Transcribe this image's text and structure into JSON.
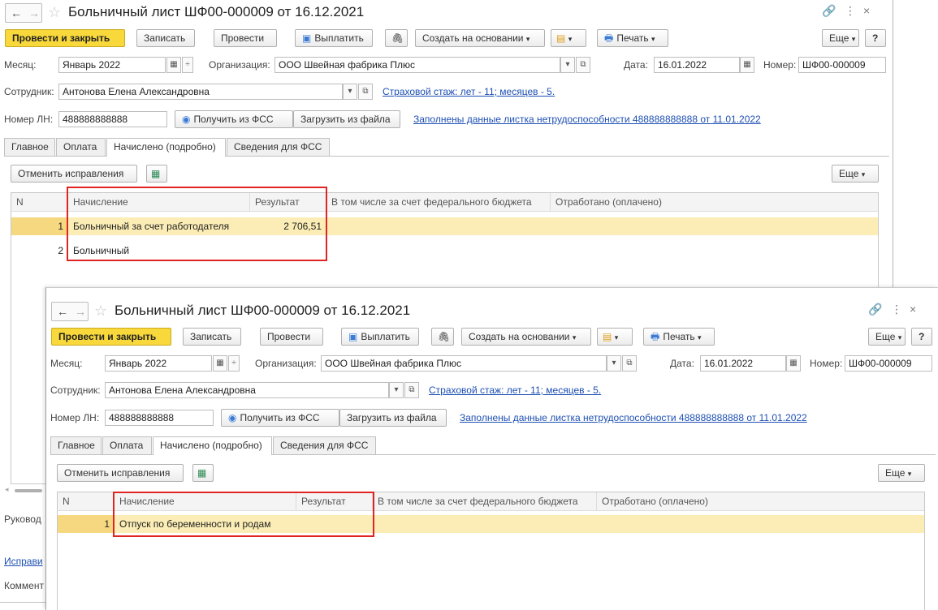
{
  "window": {
    "title": "Больничный лист ШФ00-000009 от 16.12.2021",
    "back_icon": "arrow-left-icon",
    "forward_icon": "arrow-right-icon",
    "star_icon": "star-icon",
    "link_icon": "link-icon",
    "menu_icon": "more-vertical-icon",
    "close_icon": "close-icon"
  },
  "toolbar": {
    "post_close": "Провести и закрыть",
    "save": "Записать",
    "post": "Провести",
    "pay": "Выплатить",
    "create_based": "Создать на основании",
    "print": "Печать",
    "more": "Еще",
    "help": "?"
  },
  "form": {
    "month_label": "Месяц:",
    "month_value": "Январь 2022",
    "org_label": "Организация:",
    "org_value": "ООО Швейная фабрика Плюс",
    "date_label": "Дата:",
    "date_value": "16.01.2022",
    "number_label": "Номер:",
    "number_value": "ШФ00-000009",
    "employee_label": "Сотрудник:",
    "employee_value": "Антонова Елена Александровна",
    "insurance_link": "Страховой стаж: лет - 11; месяцев - 5.",
    "ln_label": "Номер ЛН:",
    "ln_value": "488888888888",
    "get_fss": "Получить из ФСС",
    "load_file": "Загрузить из файла",
    "filled_link": "Заполнены данные листка нетрудоспособности 488888888888 от 11.01.2022"
  },
  "tabs": [
    "Главное",
    "Оплата",
    "Начислено (подробно)",
    "Сведения для ФСС"
  ],
  "table_toolbar": {
    "cancel_fixes": "Отменить исправления",
    "more": "Еще"
  },
  "columns": [
    "N",
    "Начисление",
    "Результат",
    "В том числе за счет федерального бюджета",
    "Отработано (оплачено)"
  ],
  "rows_top": [
    {
      "n": "1",
      "accrual": "Больничный за счет работодателя",
      "result": "2 706,51"
    },
    {
      "n": "2",
      "accrual": "Больничный",
      "result": ""
    }
  ],
  "rows_bottom": [
    {
      "n": "1",
      "accrual": "Отпуск по беременности и родам",
      "result": ""
    }
  ],
  "left_peek": {
    "manager": "Руковод",
    "fixes": "Исправи",
    "comment": "Коммент"
  }
}
